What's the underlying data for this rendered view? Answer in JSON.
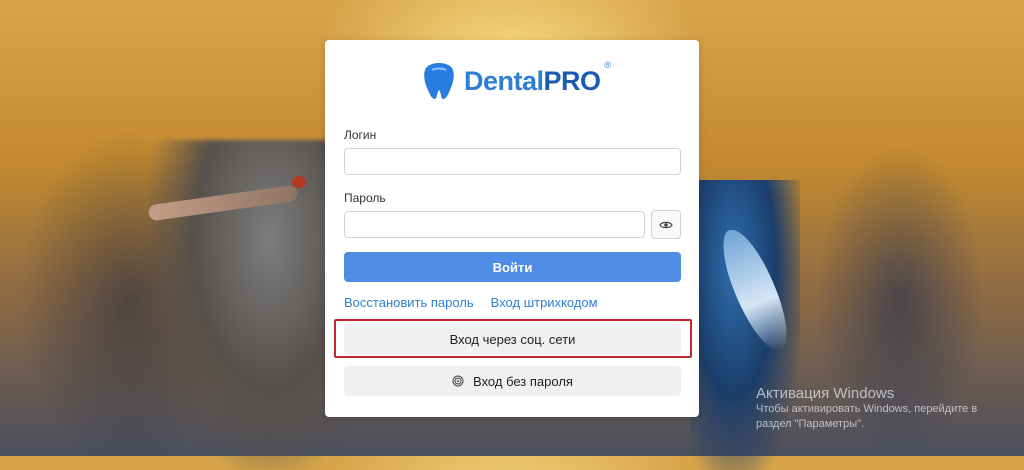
{
  "brand": {
    "name_prefix": "Dental",
    "name_suffix": "PRO",
    "reg_mark": "®",
    "color": "#2f7fd0"
  },
  "login_form": {
    "login_label": "Логин",
    "login_value": "",
    "password_label": "Пароль",
    "password_value": "",
    "show_password_icon": "eye-icon",
    "submit_label": "Войти",
    "submit_color": "#4e8ce6",
    "links": {
      "restore_password": "Восстановить пароль",
      "barcode_login": "Вход штрихкодом"
    },
    "social_login_label": "Вход через соц. сети",
    "passwordless_label": "Вход без пароля",
    "passwordless_icon": "fingerprint-icon",
    "highlight_color": "#c0282d"
  },
  "windows_watermark": {
    "title": "Активация Windows",
    "text": "Чтобы активировать Windows, перейдите в раздел \"Параметры\"."
  }
}
